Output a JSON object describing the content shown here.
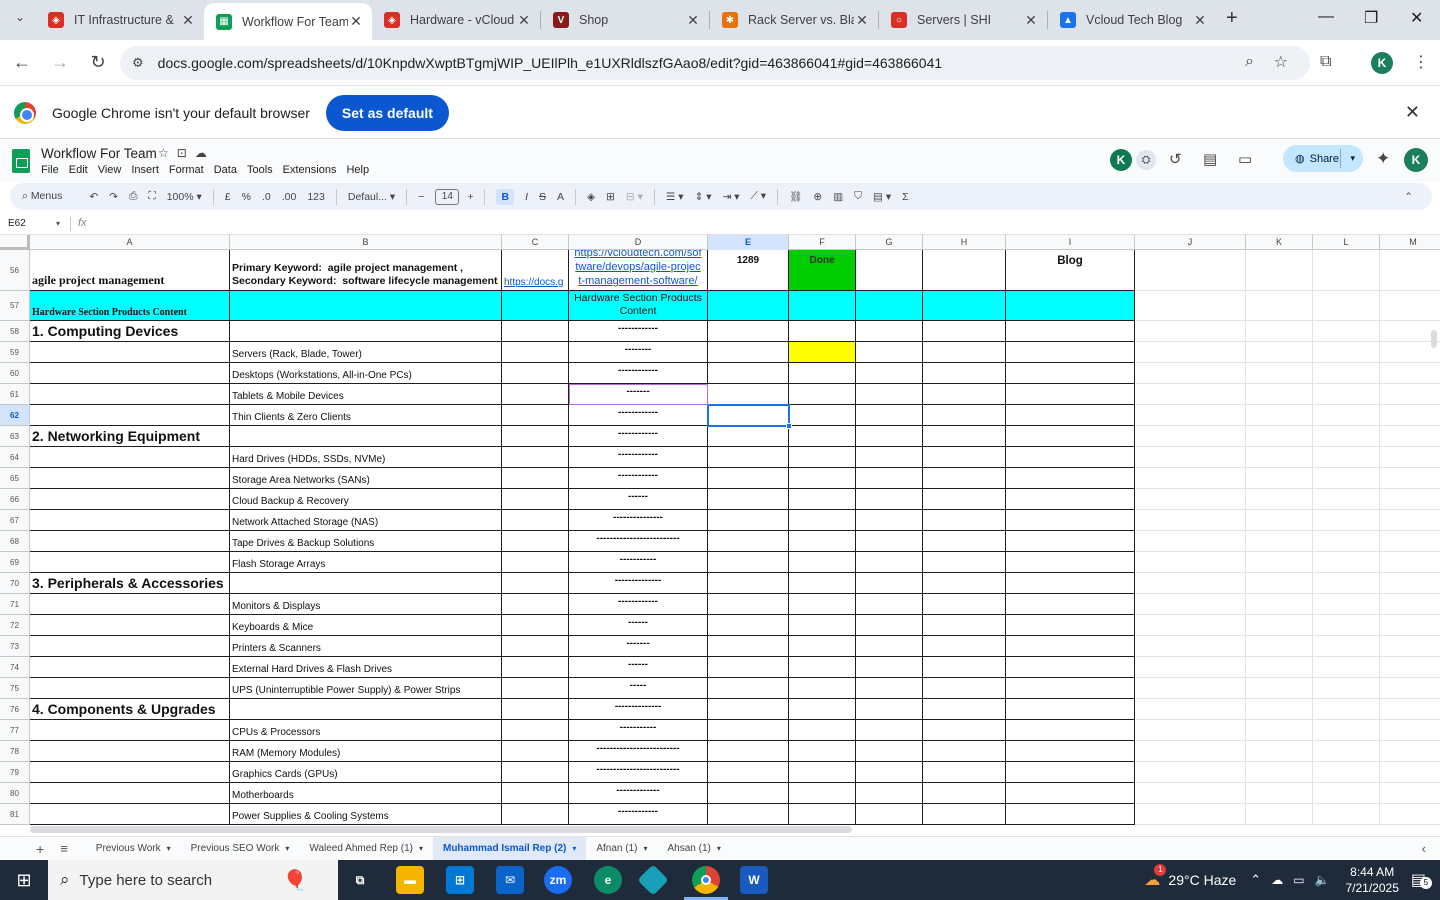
{
  "browser": {
    "tabs": [
      {
        "title": "IT Infrastructure &",
        "color": "#d93025",
        "glyph": "◈",
        "active": false
      },
      {
        "title": "Workflow For Team",
        "color": "#0f9d58",
        "glyph": "▦",
        "active": true
      },
      {
        "title": "Hardware - vCloud",
        "color": "#d93025",
        "glyph": "◈",
        "active": false
      },
      {
        "title": "Shop",
        "color": "#8b1a1a",
        "glyph": "V",
        "active": false
      },
      {
        "title": "Rack Server vs. Bla",
        "color": "#e8710a",
        "glyph": "✱",
        "active": false
      },
      {
        "title": "Servers | SHI",
        "color": "#d93025",
        "glyph": "○",
        "active": false
      },
      {
        "title": "Vcloud Tech Blog",
        "color": "#1a73e8",
        "glyph": "▲",
        "active": false
      }
    ],
    "url": "docs.google.com/spreadsheets/d/10KnpdwXwptBTgmjWIP_UEIlPlh_e1UXRldlszfGAao8/edit?gid=463866041#gid=463866041"
  },
  "infobar": {
    "message": "Google Chrome isn't your default browser",
    "button": "Set as default"
  },
  "sheets": {
    "title": "Workflow For Team",
    "menus": [
      "File",
      "Edit",
      "View",
      "Insert",
      "Format",
      "Data",
      "Tools",
      "Extensions",
      "Help"
    ],
    "share_label": "Share",
    "toolbar": {
      "menus_label": "Menus",
      "zoom": "100%",
      "currency": "£",
      "percent": "%",
      "dec_less": ".0",
      "dec_more": ".00",
      "number_format": "123",
      "font": "Defaul...",
      "font_size": "14"
    },
    "name_box": "E62",
    "columns": [
      {
        "label": "A",
        "w": 200
      },
      {
        "label": "B",
        "w": 272
      },
      {
        "label": "C",
        "w": 67
      },
      {
        "label": "D",
        "w": 139
      },
      {
        "label": "E",
        "w": 81
      },
      {
        "label": "F",
        "w": 67
      },
      {
        "label": "G",
        "w": 67
      },
      {
        "label": "H",
        "w": 83
      },
      {
        "label": "I",
        "w": 129
      },
      {
        "label": "J",
        "w": 111
      },
      {
        "label": "K",
        "w": 67
      },
      {
        "label": "L",
        "w": 67
      },
      {
        "label": "M",
        "w": 67
      }
    ],
    "rows": [
      {
        "n": "56",
        "a": "agile project management",
        "b": "Primary Keyword:  agile project management ,\nSecondary Keyword:  software lifecycle management",
        "c": "https://docs.g",
        "d": "https://vcloudtech.com/sof\ntware/devops/agile-projec\nt-management-software/",
        "e": "1289",
        "f": "Done",
        "i": "Blog"
      },
      {
        "n": "57",
        "a": "Hardware Section Products Content",
        "d": "Hardware Section Products\nContent"
      },
      {
        "n": "58",
        "a": "1. Computing Devices",
        "d": "------------"
      },
      {
        "n": "59",
        "b": "Servers (Rack, Blade, Tower)",
        "d": "--------"
      },
      {
        "n": "60",
        "b": "Desktops (Workstations, All-in-One PCs)",
        "d": "------------"
      },
      {
        "n": "61",
        "b": "Tablets & Mobile Devices",
        "d": "-------"
      },
      {
        "n": "62",
        "b": "Thin Clients & Zero Clients",
        "d": "------------"
      },
      {
        "n": "63",
        "a": "2. Networking Equipment",
        "d": "------------"
      },
      {
        "n": "64",
        "b": "Hard Drives (HDDs, SSDs, NVMe)",
        "d": "------------"
      },
      {
        "n": "65",
        "b": "Storage Area Networks (SANs)",
        "d": "------------"
      },
      {
        "n": "66",
        "b": "Cloud Backup & Recovery",
        "d": "------"
      },
      {
        "n": "67",
        "b": "Network Attached Storage (NAS)",
        "d": "---------------"
      },
      {
        "n": "68",
        "b": "Tape Drives & Backup Solutions",
        "d": "-------------------------"
      },
      {
        "n": "69",
        "b": "Flash Storage Arrays",
        "d": "-----------"
      },
      {
        "n": "70",
        "a": "3. Peripherals & Accessories",
        "d": "--------------"
      },
      {
        "n": "71",
        "b": "Monitors & Displays",
        "d": "------------"
      },
      {
        "n": "72",
        "b": "Keyboards & Mice",
        "d": "------"
      },
      {
        "n": "73",
        "b": "Printers & Scanners",
        "d": "-------"
      },
      {
        "n": "74",
        "b": "External Hard Drives & Flash Drives",
        "d": "------"
      },
      {
        "n": "75",
        "b": "UPS (Uninterruptible Power Supply) & Power Strips",
        "d": "-----"
      },
      {
        "n": "76",
        "a": "4. Components & Upgrades",
        "d": "--------------"
      },
      {
        "n": "77",
        "b": "CPUs & Processors",
        "d": "-----------"
      },
      {
        "n": "78",
        "b": "RAM (Memory Modules)",
        "d": "-------------------------"
      },
      {
        "n": "79",
        "b": "Graphics Cards (GPUs)",
        "d": "-------------------------"
      },
      {
        "n": "80",
        "b": "Motherboards",
        "d": "-------------"
      },
      {
        "n": "81",
        "b": "Power Supplies & Cooling Systems",
        "d": "------------"
      }
    ],
    "sheet_tabs": [
      {
        "label": "Previous Work",
        "active": false
      },
      {
        "label": "Previous SEO Work",
        "active": false
      },
      {
        "label": "Waleed Ahmed Rep (1)",
        "active": false
      },
      {
        "label": "Muhammad Ismail Rep (2)",
        "active": true
      },
      {
        "label": "Afnan (1)",
        "active": false
      },
      {
        "label": "Ahsan (1)",
        "active": false
      }
    ]
  },
  "taskbar": {
    "search_placeholder": "Type here to search",
    "weather": "29°C  Haze",
    "time": "8:44 AM",
    "date": "7/21/2025",
    "notification_count": "5",
    "weather_badge": "1"
  }
}
